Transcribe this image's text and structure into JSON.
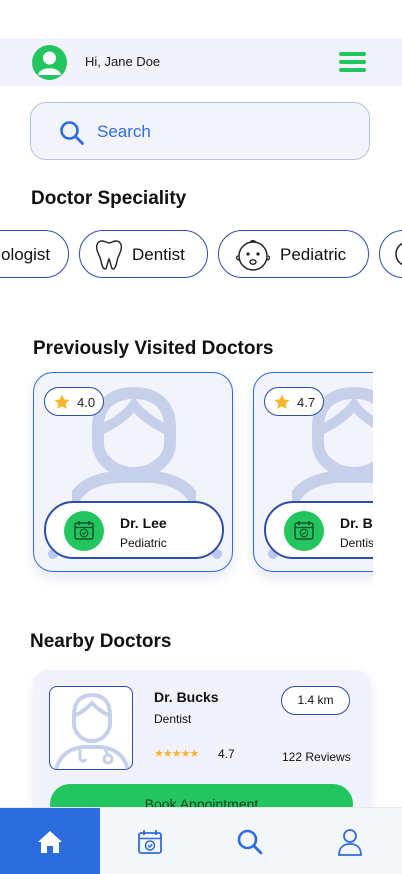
{
  "header": {
    "greeting": "Hi, Jane Doe",
    "avatar_icon": "user-icon",
    "menu_icon": "hamburger-menu-icon"
  },
  "search": {
    "placeholder": "Search",
    "icon": "search-icon"
  },
  "speciality": {
    "title": "Doctor Speciality",
    "chips": [
      {
        "label": "ologist",
        "icon": "none"
      },
      {
        "label": "Dentist",
        "icon": "tooth-icon"
      },
      {
        "label": "Pediatric",
        "icon": "baby-icon"
      },
      {
        "label": "",
        "icon": "partial-chip-icon"
      }
    ]
  },
  "previous": {
    "title": "Previously Visited Doctors",
    "doctors": [
      {
        "name": "Dr. Lee",
        "speciality": "Pediatric",
        "rating": "4.0"
      },
      {
        "name": "Dr. B",
        "speciality": "Dentis",
        "rating": "4.7"
      }
    ]
  },
  "nearby": {
    "title": "Nearby Doctors",
    "doctor": {
      "name": "Dr. Bucks",
      "speciality": "Dentist",
      "distance": "1.4 km",
      "stars": "★★★★★",
      "rating": "4.7",
      "reviews": "122 Reviews",
      "book_label": "Book Appointment"
    }
  },
  "nav": {
    "items": [
      "home-icon",
      "calendar-icon",
      "search-icon",
      "profile-icon"
    ],
    "active": "home-icon"
  },
  "colors": {
    "accent_green": "#22c55e",
    "accent_blue": "#2d6cdf",
    "outline_blue": "#2d4ea8",
    "panel_bg": "#f1f2fb",
    "star_gold": "#f7b52c"
  }
}
